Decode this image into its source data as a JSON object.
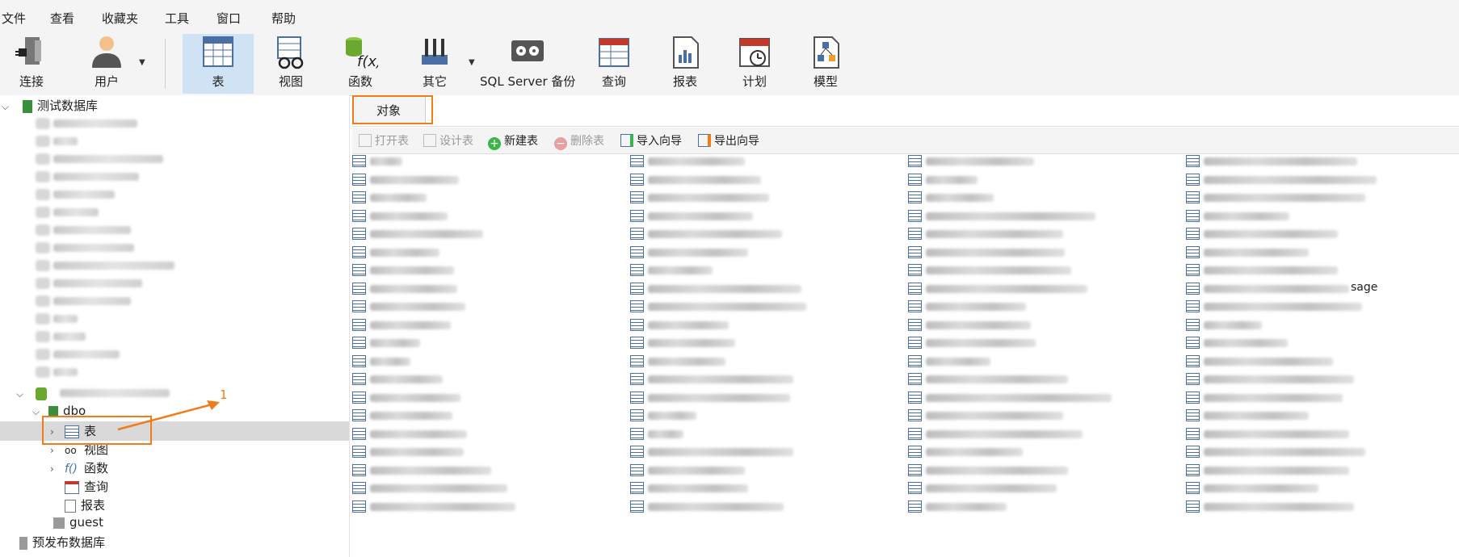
{
  "menu": [
    "文件",
    "查看",
    "收藏夹",
    "工具",
    "窗口",
    "帮助"
  ],
  "toolbar": [
    {
      "label": "连接",
      "icon": "connection-icon",
      "active": false
    },
    {
      "label": "用户",
      "icon": "user-icon",
      "active": false
    },
    {
      "label": "表",
      "icon": "table-icon",
      "active": true
    },
    {
      "label": "视图",
      "icon": "view-icon",
      "active": false
    },
    {
      "label": "函数",
      "icon": "function-icon",
      "active": false
    },
    {
      "label": "其它",
      "icon": "other-icon",
      "active": false
    },
    {
      "label": "SQL Server 备份",
      "icon": "backup-icon",
      "active": false
    },
    {
      "label": "查询",
      "icon": "query-icon",
      "active": false
    },
    {
      "label": "报表",
      "icon": "report-icon",
      "active": false
    },
    {
      "label": "计划",
      "icon": "schedule-icon",
      "active": false
    },
    {
      "label": "模型",
      "icon": "model-icon",
      "active": false
    }
  ],
  "tree": {
    "root1": "测试数据库",
    "schema": "dbo",
    "children": [
      "表",
      "视图",
      "函数",
      "查询",
      "报表"
    ],
    "guest": "guest",
    "root2": "预发布数据库"
  },
  "tab": "对象",
  "object_toolbar": [
    {
      "label": "打开表",
      "enabled": false
    },
    {
      "label": "设计表",
      "enabled": false
    },
    {
      "label": "新建表",
      "enabled": true
    },
    {
      "label": "删除表",
      "enabled": false
    },
    {
      "label": "导入向导",
      "enabled": true
    },
    {
      "label": "导出向导",
      "enabled": true
    }
  ],
  "visible_fragment": "sage",
  "annotation_number": "1",
  "colors": {
    "accent": "#f07c1c",
    "selection": "#cfe3f5",
    "toolbar_bg": "#f4f4f4"
  }
}
